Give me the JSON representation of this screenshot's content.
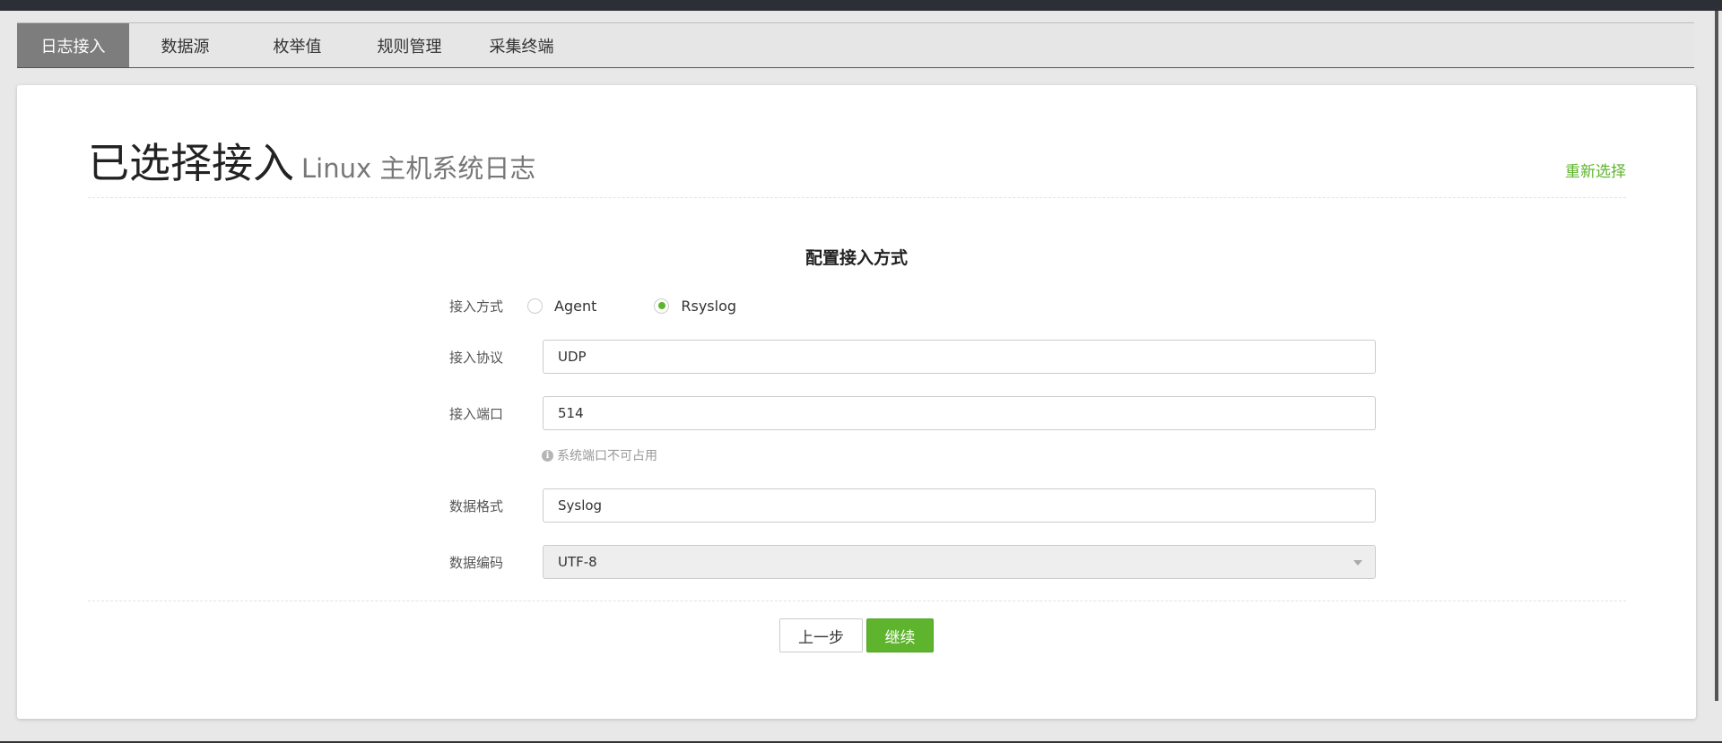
{
  "tabs": [
    {
      "label": "日志接入",
      "active": true
    },
    {
      "label": "数据源",
      "active": false
    },
    {
      "label": "枚举值",
      "active": false
    },
    {
      "label": "规则管理",
      "active": false
    },
    {
      "label": "采集终端",
      "active": false
    }
  ],
  "header": {
    "title": "已选择接入",
    "subtitle": "Linux 主机系统日志",
    "reselect_label": "重新选择"
  },
  "form": {
    "section_title": "配置接入方式",
    "method": {
      "label": "接入方式",
      "options": [
        {
          "label": "Agent",
          "checked": false
        },
        {
          "label": "Rsyslog",
          "checked": true
        }
      ]
    },
    "protocol": {
      "label": "接入协议",
      "value": "UDP"
    },
    "port": {
      "label": "接入端口",
      "value": "514",
      "hint": "系统端口不可占用",
      "hint_icon": "info-icon"
    },
    "format": {
      "label": "数据格式",
      "value": "Syslog"
    },
    "encoding": {
      "label": "数据编码",
      "value": "UTF-8",
      "disabled": true
    }
  },
  "buttons": {
    "prev_label": "上一步",
    "next_label": "继续"
  },
  "colors": {
    "accent": "#5eb42d",
    "active_tab": "#7d7d7d"
  }
}
